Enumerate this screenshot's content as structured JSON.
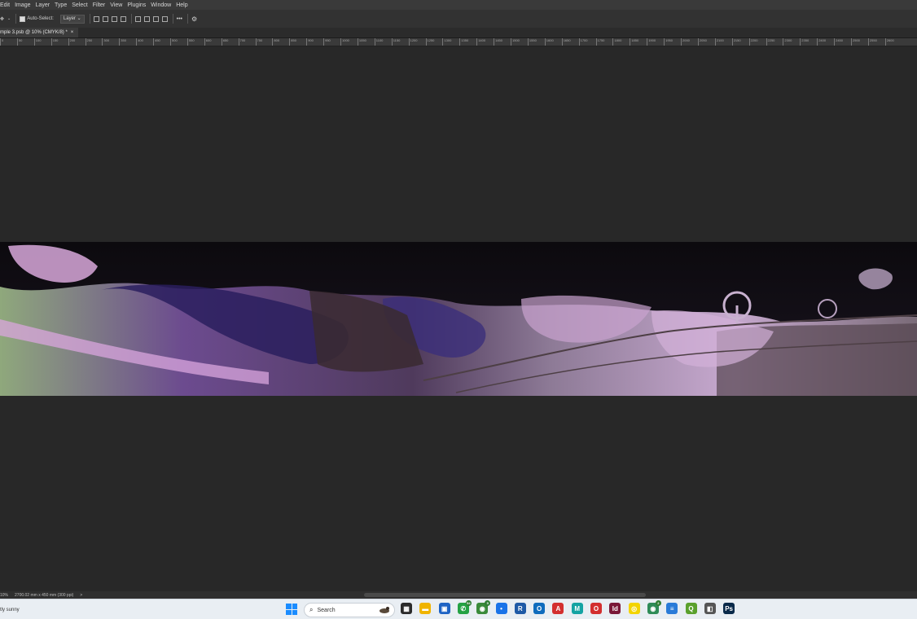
{
  "menu": [
    "Edit",
    "Image",
    "Layer",
    "Type",
    "Select",
    "Filter",
    "View",
    "Plugins",
    "Window",
    "Help"
  ],
  "options": {
    "auto_select_label": "Auto-Select:",
    "layer_select_value": "Layer",
    "more_label": "•••"
  },
  "document_tab": {
    "title": "mple 3.psb @ 10% (CMYK/8) *",
    "close_label": "×"
  },
  "ruler": {
    "ticks": [
      "0",
      "50",
      "100",
      "150",
      "200",
      "250",
      "300",
      "350",
      "400",
      "450",
      "500",
      "550",
      "600",
      "650",
      "700",
      "750",
      "800",
      "850",
      "900",
      "950",
      "1000",
      "1050",
      "1100",
      "1150",
      "1200",
      "1250",
      "1300",
      "1350",
      "1400",
      "1450",
      "1500",
      "1550",
      "1600",
      "1650",
      "1700",
      "1750",
      "1800",
      "1850",
      "1900",
      "1950",
      "2000",
      "2050",
      "2100",
      "2150",
      "2200",
      "2250",
      "2300",
      "2350",
      "2400",
      "2450",
      "2500",
      "2550",
      "2600"
    ]
  },
  "status": {
    "zoom": "10%",
    "dimensions": "2700.02 mm x 450 mm (300 ppi)",
    "arrow": ">"
  },
  "taskbar": {
    "weather": "tly sunny",
    "search_placeholder": "Search",
    "apps": [
      {
        "name": "task-view",
        "glyph": "▦",
        "color": "#2b2b2b"
      },
      {
        "name": "file-explorer",
        "glyph": "▬",
        "color": "#f0b400"
      },
      {
        "name": "store",
        "glyph": "▣",
        "color": "#1e63c4"
      },
      {
        "name": "whatsapp",
        "glyph": "✆",
        "color": "#25a244",
        "badge": "54"
      },
      {
        "name": "chrome",
        "glyph": "◉",
        "color": "#3a8a3a",
        "badge": "5"
      },
      {
        "name": "app-blue",
        "glyph": "•",
        "color": "#1a73e8"
      },
      {
        "name": "revit",
        "glyph": "R",
        "color": "#1f5aa6"
      },
      {
        "name": "outlook",
        "glyph": "O",
        "color": "#0f6cbd"
      },
      {
        "name": "acrobat",
        "glyph": "A",
        "color": "#d32f2f"
      },
      {
        "name": "app-m",
        "glyph": "M",
        "color": "#15a3a3"
      },
      {
        "name": "opera",
        "glyph": "O",
        "color": "#d32f2f"
      },
      {
        "name": "indesign",
        "glyph": "Id",
        "color": "#7a1838"
      },
      {
        "name": "snapchat",
        "glyph": "◎",
        "color": "#f3d400"
      },
      {
        "name": "chrome-2",
        "glyph": "◉",
        "color": "#2e8b57",
        "badge": "2"
      },
      {
        "name": "notepad",
        "glyph": "≡",
        "color": "#2a7bd8"
      },
      {
        "name": "qgis",
        "glyph": "Q",
        "color": "#5aa02c"
      },
      {
        "name": "app-gray",
        "glyph": "◧",
        "color": "#555555"
      },
      {
        "name": "photoshop",
        "glyph": "Ps",
        "color": "#0a2a4a"
      }
    ]
  }
}
